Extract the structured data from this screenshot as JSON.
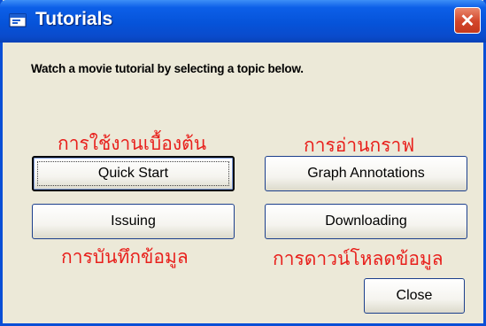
{
  "window": {
    "title": "Tutorials",
    "title_icon": "application-window-icon",
    "close_icon": "close-x-icon",
    "close_glyph": "✕"
  },
  "instruction": "Watch a movie tutorial by selecting a topic below.",
  "annotations": {
    "quick_start": "การใช้งานเบื้องต้น",
    "graph_annotations": "การอ่านกราฟ",
    "issuing": "การบันทึกข้อมูล",
    "downloading": "การดาวน์โหลดข้อมูล"
  },
  "buttons": {
    "quick_start": "Quick Start",
    "graph_annotations": "Graph Annotations",
    "issuing": "Issuing",
    "downloading": "Downloading",
    "close": "Close"
  },
  "colors": {
    "titlebar": "#0653d9",
    "dialog_bg": "#ece9d8",
    "annotation_red": "#e8201c"
  }
}
